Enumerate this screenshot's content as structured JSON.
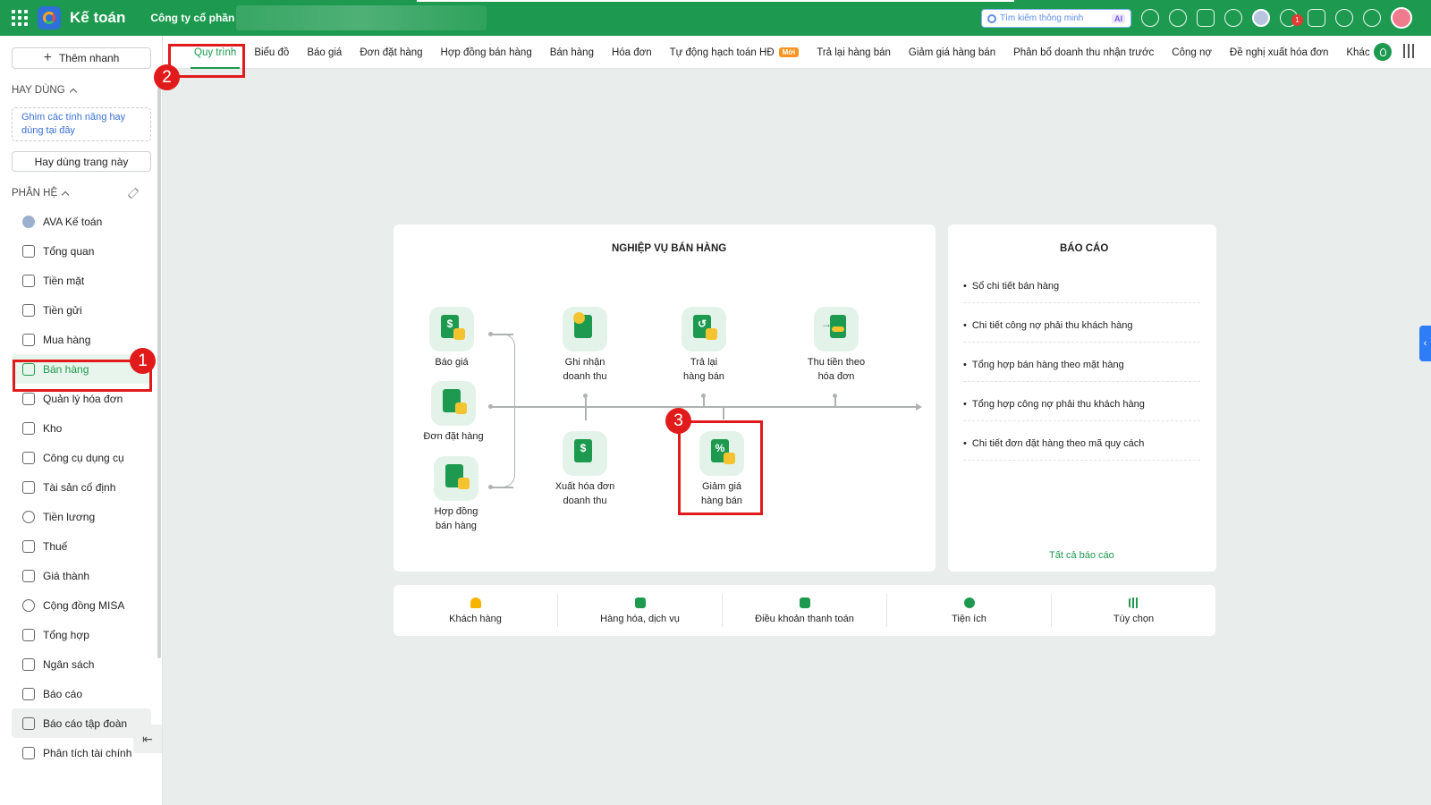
{
  "topbar": {
    "app_title": "Kế toán",
    "company": "Công ty cổ phần",
    "search_placeholder": "Tìm kiếm thông minh",
    "search_ai": "AI",
    "chat_badge": "1",
    "brand_color": "#1d9a4f",
    "icons": [
      "apps-grid-icon",
      "download-icon",
      "play-icon",
      "bell-ring-icon",
      "gear-icon",
      "avatar",
      "chat-icon",
      "bell-icon",
      "help-icon",
      "more-icon",
      "user-avatar"
    ]
  },
  "sidebar": {
    "quick_add": "Thêm nhanh",
    "frequent_title": "HAY DÙNG",
    "pin_hint": "Ghim các tính năng hay dùng tại đây",
    "pin_page": "Hay dùng trang này",
    "modules_title": "PHÂN HỆ",
    "items": [
      {
        "label": "AVA Kế toán",
        "icon": "ava-avatar-icon"
      },
      {
        "label": "Tổng quan",
        "icon": "dashboard-icon"
      },
      {
        "label": "Tiền mặt",
        "icon": "cash-icon"
      },
      {
        "label": "Tiền gửi",
        "icon": "bank-icon"
      },
      {
        "label": "Mua hàng",
        "icon": "shopping-bag-icon"
      },
      {
        "label": "Bán hàng",
        "icon": "cart-icon",
        "active": true
      },
      {
        "label": "Quản lý hóa đơn",
        "icon": "invoice-icon"
      },
      {
        "label": "Kho",
        "icon": "warehouse-icon"
      },
      {
        "label": "Công cụ dụng cụ",
        "icon": "tools-icon"
      },
      {
        "label": "Tài sản cố định",
        "icon": "truck-icon"
      },
      {
        "label": "Tiền lương",
        "icon": "salary-icon"
      },
      {
        "label": "Thuế",
        "icon": "tax-icon"
      },
      {
        "label": "Giá thành",
        "icon": "price-tag-icon"
      },
      {
        "label": "Cộng đồng MISA",
        "icon": "community-icon"
      },
      {
        "label": "Tổng hợp",
        "icon": "ledger-icon"
      },
      {
        "label": "Ngân sách",
        "icon": "budget-icon"
      },
      {
        "label": "Báo cáo",
        "icon": "bar-chart-icon"
      },
      {
        "label": "Báo cáo tập đoàn",
        "icon": "group-report-icon"
      },
      {
        "label": "Phân tích tài chính",
        "icon": "analytics-icon"
      }
    ]
  },
  "tabs": [
    {
      "label": "Quy trình",
      "active": true
    },
    {
      "label": "Biểu đồ"
    },
    {
      "label": "Báo giá"
    },
    {
      "label": "Đơn đặt hàng"
    },
    {
      "label": "Hợp đồng bán hàng"
    },
    {
      "label": "Bán hàng"
    },
    {
      "label": "Hóa đơn"
    },
    {
      "label": "Tự động hạch toán HĐ",
      "badge": "Mới"
    },
    {
      "label": "Trả lại hàng bán"
    },
    {
      "label": "Giảm giá hàng bán"
    },
    {
      "label": "Phân bổ doanh thu nhận trước"
    },
    {
      "label": "Công nợ"
    },
    {
      "label": "Đề nghị xuất hóa đơn"
    },
    {
      "label": "Khác",
      "dropdown": true
    }
  ],
  "process": {
    "title": "NGHIỆP VỤ BÁN HÀNG",
    "steps": {
      "quote": "Báo giá",
      "order": "Đơn đặt hàng",
      "contract_l1": "Hợp đồng",
      "contract_l2": "bán hàng",
      "revenue_l1": "Ghi nhận",
      "revenue_l2": "doanh thu",
      "return_l1": "Trả lại",
      "return_l2": "hàng bán",
      "collect_l1": "Thu tiền theo",
      "collect_l2": "hóa đơn",
      "issue_l1": "Xuất hóa đơn",
      "issue_l2": "doanh thu",
      "discount_l1": "Giảm giá",
      "discount_l2": "hàng bán"
    }
  },
  "reports": {
    "title": "BÁO CÁO",
    "items": [
      "Sổ chi tiết bán hàng",
      "Chi tiết công nợ phải thu khách hàng",
      "Tổng hợp bán hàng theo mặt hàng",
      "Tổng hợp công nợ phải thu khách hàng",
      "Chi tiết đơn đặt hàng theo mã quy cách"
    ],
    "all": "Tất cả báo cáo"
  },
  "bottom": [
    "Khách hàng",
    "Hàng hóa, dịch vụ",
    "Điều khoản thanh toán",
    "Tiện ích",
    "Tùy chọn"
  ],
  "annotations": [
    "1",
    "2",
    "3"
  ]
}
